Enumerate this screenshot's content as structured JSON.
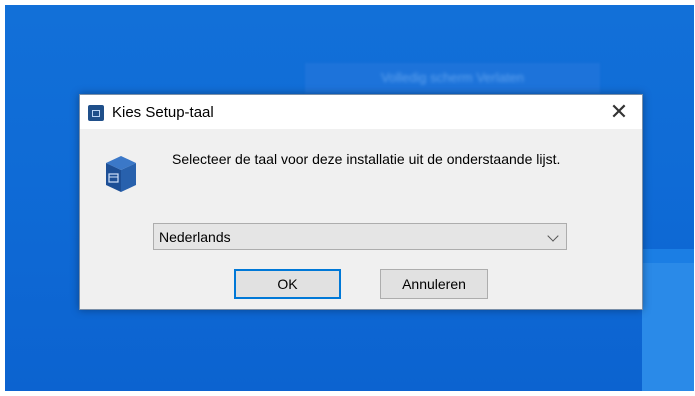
{
  "background": {
    "window_title": "Volledig scherm Verlaten"
  },
  "dialog": {
    "title": "Kies Setup-taal",
    "close_glyph": "✕",
    "message": "Selecteer de taal voor deze installatie uit de onderstaande lijst.",
    "language_select": {
      "selected": "Nederlands"
    },
    "ok_label": "OK",
    "cancel_label": "Annuleren"
  },
  "colors": {
    "desktop": "#0f6bd6",
    "dialog_bg": "#f0f0f0",
    "focus_border": "#0078d7"
  },
  "icons": [
    "setup-app-icon",
    "installer-box-icon",
    "close-icon",
    "chevron-down-icon"
  ]
}
